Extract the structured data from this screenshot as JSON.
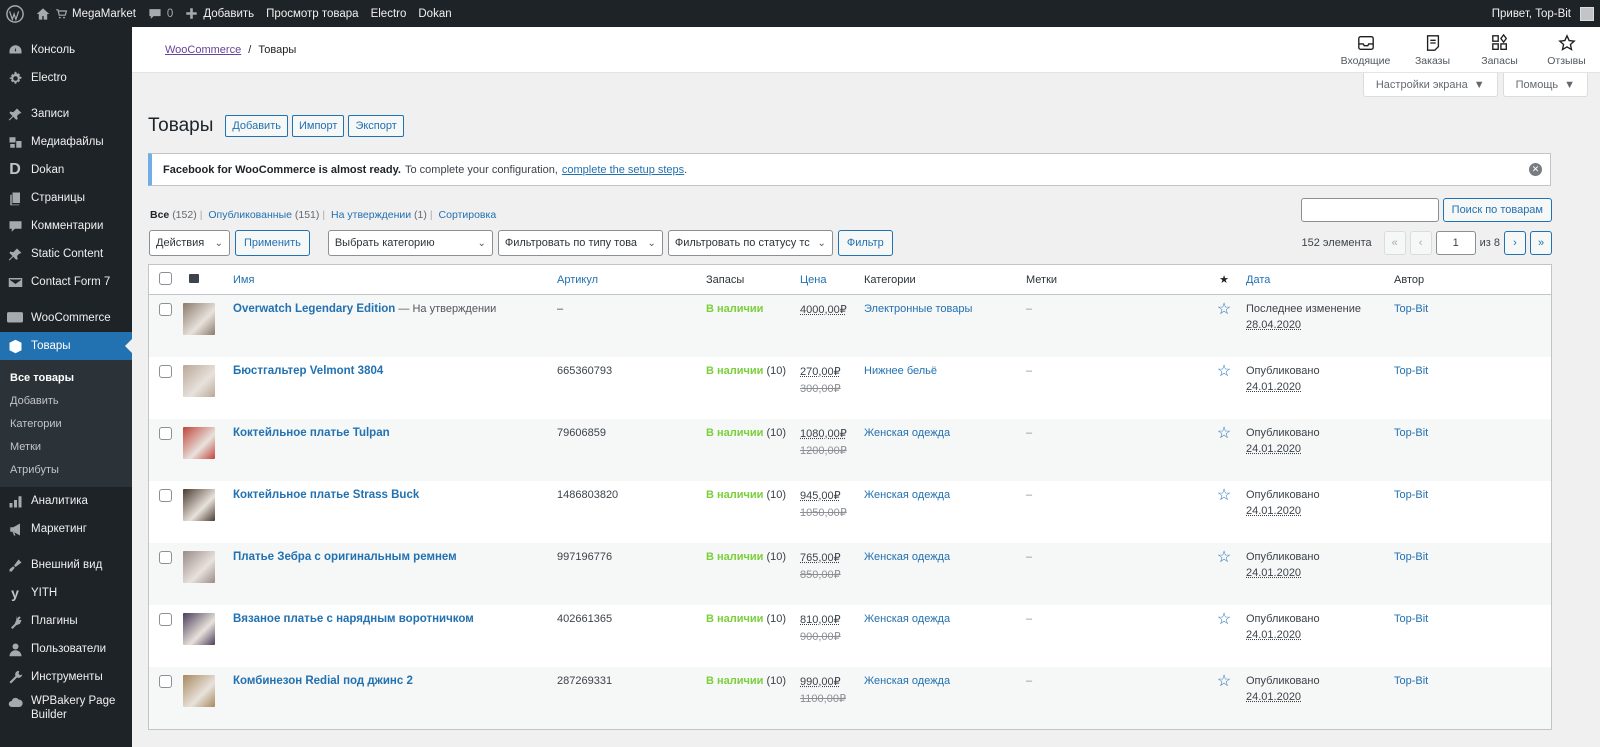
{
  "adminbar": {
    "site_name": "MegaMarket",
    "comments_count": "0",
    "add_label": "Добавить",
    "view_product": "Просмотр товара",
    "electro": "Electro",
    "dokan": "Dokan",
    "greeting": "Привет, Top-Bit"
  },
  "sidebar": {
    "items": [
      {
        "label": "Консоль",
        "icon": "dashboard-icon"
      },
      {
        "label": "Electro",
        "icon": "gear-icon"
      },
      {
        "label": "Записи",
        "icon": "pin-icon"
      },
      {
        "label": "Медиафайлы",
        "icon": "media-icon"
      },
      {
        "label": "Dokan",
        "icon": "dokan-icon"
      },
      {
        "label": "Страницы",
        "icon": "pages-icon"
      },
      {
        "label": "Комментарии",
        "icon": "comment-icon"
      },
      {
        "label": "Static Content",
        "icon": "pin-icon"
      },
      {
        "label": "Contact Form 7",
        "icon": "mail-icon"
      },
      {
        "label": "WooCommerce",
        "icon": "woo-icon"
      },
      {
        "label": "Товары",
        "icon": "box-icon"
      },
      {
        "label": "Аналитика",
        "icon": "chart-icon"
      },
      {
        "label": "Маркетинг",
        "icon": "megaphone-icon"
      },
      {
        "label": "Внешний вид",
        "icon": "brush-icon"
      },
      {
        "label": "YITH",
        "icon": "yith-icon"
      },
      {
        "label": "Плагины",
        "icon": "plugin-icon"
      },
      {
        "label": "Пользователи",
        "icon": "user-icon"
      },
      {
        "label": "Инструменты",
        "icon": "wrench-icon"
      },
      {
        "label": "WPBakery Page Builder",
        "icon": "cloud-icon"
      }
    ],
    "submenu": [
      "Все товары",
      "Добавить",
      "Категории",
      "Метки",
      "Атрибуты"
    ]
  },
  "header": {
    "breadcrumb_link": "WooCommerce",
    "breadcrumb_sep": "/",
    "breadcrumb_current": "Товары",
    "icons": [
      {
        "label": "Входящие",
        "icon": "inbox-icon"
      },
      {
        "label": "Заказы",
        "icon": "orders-icon"
      },
      {
        "label": "Запасы",
        "icon": "stock-icon"
      },
      {
        "label": "Отзывы",
        "icon": "star-icon"
      }
    ],
    "screen_options": "Настройки экрана",
    "help": "Помощь"
  },
  "page": {
    "title": "Товары",
    "actions": [
      "Добавить",
      "Импорт",
      "Экспорт"
    ],
    "notice_bold": "Facebook for WooCommerce is almost ready.",
    "notice_text": "To complete your configuration,",
    "notice_link": "complete the setup steps",
    "notice_end": "."
  },
  "views": {
    "all": "Все",
    "all_count": "(152)",
    "published": "Опубликованные",
    "published_count": "(151)",
    "pending": "На утверждении",
    "pending_count": "(1)",
    "sort": "Сортировка"
  },
  "search": {
    "value": "",
    "button": "Поиск по товарам"
  },
  "tablenav": {
    "bulk_actions": "Действия",
    "apply": "Применить",
    "category": "Выбрать категорию",
    "type_filter": "Фильтровать по типу това",
    "status_filter": "Фильтровать по статусу тс",
    "filter": "Фильтр",
    "items_count": "152 элемента",
    "first": "«",
    "prev": "‹",
    "current_page": "1",
    "of": "из 8",
    "next": "›",
    "last": "»"
  },
  "table": {
    "columns": {
      "name": "Имя",
      "sku": "Артикул",
      "stock": "Запасы",
      "price": "Цена",
      "categories": "Категории",
      "tags": "Метки",
      "featured": "★",
      "date": "Дата",
      "author": "Автор"
    },
    "rows": [
      {
        "name": "Overwatch Legendary Edition",
        "state": "— На утверждении",
        "sku": "–",
        "stock": "В наличии",
        "stock_qty": "",
        "price": "4000,00₽",
        "old_price": "",
        "category": "Электронные товары",
        "tags": "–",
        "date_label": "Последнее изменение",
        "date": "28.04.2020",
        "author": "Top-Bit",
        "thumb_color": "#8a7a6a"
      },
      {
        "name": "Бюстгальтер Velmont 3804",
        "state": "",
        "sku": "665360793",
        "stock": "В наличии",
        "stock_qty": "(10)",
        "price": "270,00₽",
        "old_price": "300,00₽",
        "category": "Нижнее бельё",
        "tags": "–",
        "date_label": "Опубликовано",
        "date": "24.01.2020",
        "author": "Top-Bit",
        "thumb_color": "#b9a898"
      },
      {
        "name": "Коктейльное платье Tulpan",
        "state": "",
        "sku": "79606859",
        "stock": "В наличии",
        "stock_qty": "(10)",
        "price": "1080,00₽",
        "old_price": "1200,00₽",
        "category": "Женская одежда",
        "tags": "–",
        "date_label": "Опубликовано",
        "date": "24.01.2020",
        "author": "Top-Bit",
        "thumb_color": "#c0443a"
      },
      {
        "name": "Коктейльное платье Strass Buck",
        "state": "",
        "sku": "1486803820",
        "stock": "В наличии",
        "stock_qty": "(10)",
        "price": "945,00₽",
        "old_price": "1050,00₽",
        "category": "Женская одежда",
        "tags": "–",
        "date_label": "Опубликовано",
        "date": "24.01.2020",
        "author": "Top-Bit",
        "thumb_color": "#4a3a2e"
      },
      {
        "name": "Платье Зебра с оригинальным ремнем",
        "state": "",
        "sku": "997196776",
        "stock": "В наличии",
        "stock_qty": "(10)",
        "price": "765,00₽",
        "old_price": "850,00₽",
        "category": "Женская одежда",
        "tags": "–",
        "date_label": "Опубликовано",
        "date": "24.01.2020",
        "author": "Top-Bit",
        "thumb_color": "#9a8a88"
      },
      {
        "name": "Вязаное платье с нарядным воротничком",
        "state": "",
        "sku": "402661365",
        "stock": "В наличии",
        "stock_qty": "(10)",
        "price": "810,00₽",
        "old_price": "900,00₽",
        "category": "Женская одежда",
        "tags": "–",
        "date_label": "Опубликовано",
        "date": "24.01.2020",
        "author": "Top-Bit",
        "thumb_color": "#4a3e58"
      },
      {
        "name": "Комбинезон Redial под джинс 2",
        "state": "",
        "sku": "287269331",
        "stock": "В наличии",
        "stock_qty": "(10)",
        "price": "990,00₽",
        "old_price": "1100,00₽",
        "category": "Женская одежда",
        "tags": "–",
        "date_label": "Опубликовано",
        "date": "24.01.2020",
        "author": "Top-Bit",
        "thumb_color": "#a8885e"
      }
    ]
  },
  "colors": {
    "accent": "#2271b1",
    "in_stock": "#7ad03a",
    "sidebar_bg": "#1d2327",
    "active_menu": "#2271b1"
  }
}
